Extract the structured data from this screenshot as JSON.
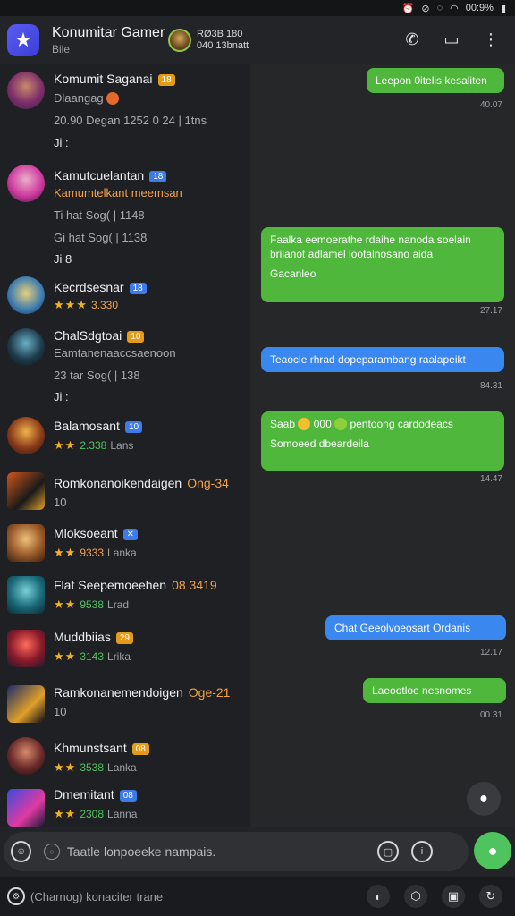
{
  "status_bar": {
    "time": "00:9%",
    "icons": [
      "alarm-icon",
      "mute-icon",
      "silent-icon",
      "wifi-icon"
    ]
  },
  "header": {
    "title": "Konumitar Gamer",
    "subtitle": "Bile",
    "user_line1": "RØ3B 180",
    "user_line2": "040 13bnatt"
  },
  "conversations": [
    {
      "name": "Komumit Saganai",
      "badge": "18",
      "badge_color": "orange",
      "line1": "Dlaangag",
      "line2": "20.90 Degan 1252 0 24 | 1tns",
      "line3": "Ji :"
    },
    {
      "name": "Kamutcuelantan",
      "badge": "18",
      "badge_color": "blue",
      "line1": "Kamumtelkant meemsan",
      "line2": "Ti hat Sog( |  1148",
      "line3": "Gi hat Sog( | 1138",
      "line4": "Ji 8"
    },
    {
      "name": "Kecrdsesnar",
      "badge": "18",
      "badge_color": "blue",
      "stars": "★★★",
      "rating": "3.330",
      "rating_color": "orange"
    },
    {
      "name": "ChalSdgtoai",
      "badge": "10",
      "badge_color": "orange",
      "line1": "Eamtanenaaccsaenoon",
      "line2": "23 tar Sog( |  138",
      "line3": "Ji :"
    },
    {
      "name": "Balamosant",
      "badge": "10",
      "badge_color": "blue",
      "stars": "★★",
      "rating": "2.338",
      "suffix": "Lans"
    },
    {
      "name": "Romkonanoikendaigen",
      "extra": "Ong-34",
      "line1": "10"
    },
    {
      "name": "Mloksoeant",
      "badge": "✕",
      "badge_color": "blue",
      "stars": "★★",
      "rating": "9333",
      "suffix": "Lanka"
    },
    {
      "name": "Flat Seepemoeehen",
      "extra": "08 3419",
      "stars": "★★",
      "rating": "9538",
      "suffix": "Lrad"
    },
    {
      "name": "Muddbiias",
      "badge": "29",
      "badge_color": "orange",
      "stars": "★★",
      "rating": "3143",
      "suffix": "Lrika"
    },
    {
      "name": "Ramkonanemendoigen",
      "extra": "Oge-21",
      "line1": "10"
    },
    {
      "name": "Khmunstsant",
      "badge": "08",
      "badge_color": "orange",
      "stars": "★★",
      "rating": "3538",
      "suffix": "Lanka"
    },
    {
      "name": "Dmemitant",
      "badge": "08",
      "badge_color": "blue",
      "stars": "★★",
      "rating": "2308",
      "suffix": "Lanna"
    }
  ],
  "messages": [
    {
      "text": "Leepon 0itelis kesaliten",
      "color": "green",
      "time": "40.07"
    },
    {
      "text": "Faalka eemoerathe rdaihe nanoda soelain briianot adlamel lootalnosano aida",
      "text2": "Gacanleo",
      "color": "green",
      "time": "27.17"
    },
    {
      "text": "Teaocle rhrad dopeparambang raalapeikt",
      "color": "blue",
      "time": "84.31"
    },
    {
      "text": "Saab",
      "text_mid": "000",
      "text_end": "pentoong cardodeacs",
      "text2": "Somoeed dbeardeila",
      "color": "green",
      "time": "14.47"
    },
    {
      "text": "Chat Geeolvoeosart Ordanis",
      "color": "blue",
      "time": "12.17"
    },
    {
      "text": "Laeootloe nesnomes",
      "color": "green",
      "time": "00.31"
    }
  ],
  "composer": {
    "placeholder": "Taatle lonpoeeke nampais."
  },
  "bottom_bar": {
    "label": "(Charnog) konaciter trane"
  }
}
